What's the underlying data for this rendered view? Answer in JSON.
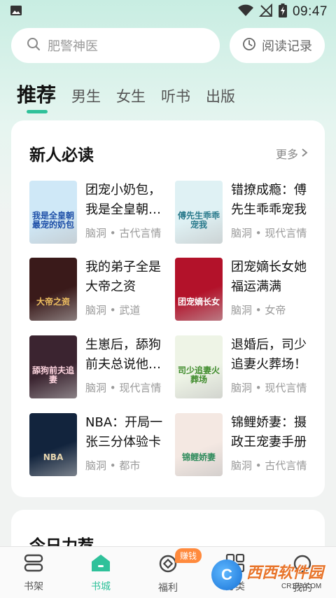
{
  "status_bar": {
    "time": "09:47",
    "icons": [
      "image-icon",
      "wifi-icon",
      "no-signal-icon",
      "battery-charging-icon"
    ]
  },
  "search": {
    "placeholder": "肥警神医",
    "history_label": "阅读记录"
  },
  "tabs": [
    {
      "label": "推荐",
      "active": true
    },
    {
      "label": "男生",
      "active": false
    },
    {
      "label": "女生",
      "active": false
    },
    {
      "label": "听书",
      "active": false
    },
    {
      "label": "出版",
      "active": false
    }
  ],
  "section_new": {
    "title": "新人必读",
    "more_label": "更多",
    "books": [
      {
        "title": "团宠小奶包，我是全皇朝…",
        "meta": "脑洞 • 古代言情",
        "cover_text": "我是全皇朝最宠的奶包",
        "cover_bg": "#cfe8f7",
        "cover_fg": "#1d4fa8"
      },
      {
        "title": "错撩成瘾：傅先生乖乖宠我",
        "meta": "脑洞 • 现代言情",
        "cover_text": "傅先生乖乖宠我",
        "cover_bg": "#dff1f4",
        "cover_fg": "#2a7a8c"
      },
      {
        "title": "我的弟子全是大帝之资",
        "meta": "脑洞 • 武道",
        "cover_text": "大帝之资",
        "cover_bg": "#3a1a1a",
        "cover_fg": "#f0c060"
      },
      {
        "title": "团宠嫡长女她福运满满",
        "meta": "脑洞 • 女帝",
        "cover_text": "团宠嫡长女",
        "cover_bg": "#b3122a",
        "cover_fg": "#ffffff"
      },
      {
        "title": "生崽后，舔狗前夫总说他…",
        "meta": "脑洞 • 现代言情",
        "cover_text": "舔狗前夫追妻",
        "cover_bg": "#3b2430",
        "cover_fg": "#ffd6e0"
      },
      {
        "title": "退婚后，司少追妻火葬场！",
        "meta": "脑洞 • 现代言情",
        "cover_text": "司少追妻火葬场",
        "cover_bg": "#eef4e6",
        "cover_fg": "#3d8a2a"
      },
      {
        "title": "NBA：开局一张三分体验卡",
        "meta": "脑洞 • 都市",
        "cover_text": "NBA",
        "cover_bg": "#12243d",
        "cover_fg": "#e8d7b0"
      },
      {
        "title": "锦鲤娇妻：摄政王宠妻手册",
        "meta": "脑洞 • 古代言情",
        "cover_text": "锦鲤娇妻",
        "cover_bg": "#f4e8e2",
        "cover_fg": "#2c8a5a"
      }
    ]
  },
  "section_today": {
    "title": "今日力荐"
  },
  "bottom_nav": [
    {
      "label": "书架",
      "icon": "bookshelf-icon",
      "active": false
    },
    {
      "label": "书城",
      "icon": "home-icon",
      "active": true
    },
    {
      "label": "福利",
      "icon": "coin-icon",
      "active": false,
      "badge": "赚钱"
    },
    {
      "label": "分类",
      "icon": "grid-icon",
      "active": false
    },
    {
      "label": "我的",
      "icon": "profile-icon",
      "active": false
    }
  ],
  "watermark": {
    "logo": "C",
    "main": "西西软件园",
    "sub": "CR173.COM"
  },
  "colors": {
    "accent": "#2fc19a",
    "badge": "#ff8a3d"
  }
}
